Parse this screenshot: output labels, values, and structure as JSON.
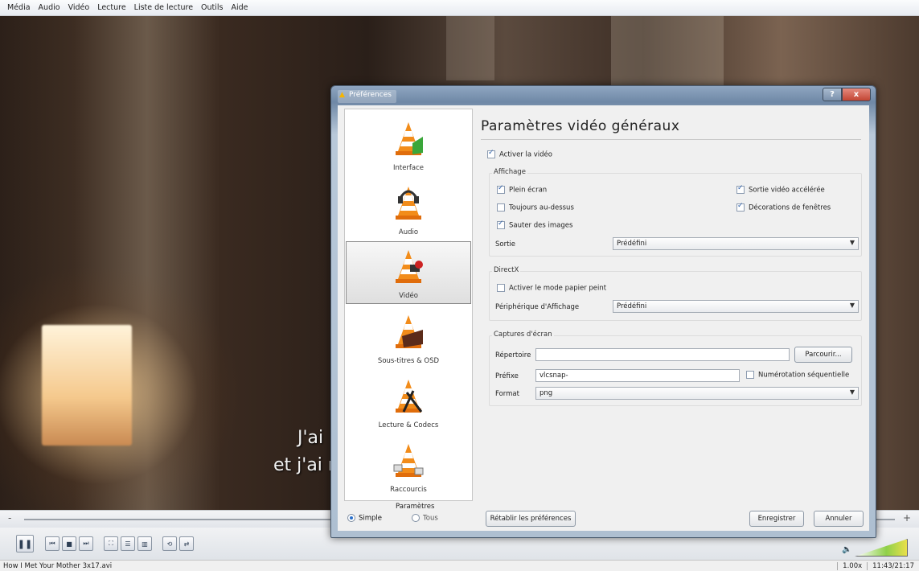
{
  "menubar": {
    "items": [
      "Média",
      "Audio",
      "Vidéo",
      "Lecture",
      "Liste de lecture",
      "Outils",
      "Aide"
    ]
  },
  "video": {
    "subtitle_line1": "J'ai",
    "subtitle_line2": "et j'ai r"
  },
  "controls": {
    "seek_minus": "-",
    "seek_plus": "+",
    "buttons": [
      {
        "name": "play-pause-button",
        "icon": "pause-icon",
        "glyph": "❚❚"
      },
      {
        "name": "previous-button",
        "icon": "previous-icon",
        "glyph": "⏮"
      },
      {
        "name": "stop-button",
        "icon": "stop-icon",
        "glyph": "■"
      },
      {
        "name": "next-button",
        "icon": "next-icon",
        "glyph": "⏭"
      },
      {
        "name": "fullscreen-button",
        "icon": "fullscreen-icon",
        "glyph": "⛶"
      },
      {
        "name": "extended-settings-button",
        "icon": "extended-settings-icon",
        "glyph": "☰"
      },
      {
        "name": "playlist-button",
        "icon": "playlist-icon",
        "glyph": "▥"
      },
      {
        "name": "loop-button",
        "icon": "loop-icon",
        "glyph": "⟲"
      },
      {
        "name": "random-button",
        "icon": "random-icon",
        "glyph": "⇄"
      }
    ],
    "volume_icon": "🔈"
  },
  "status": {
    "file": "How I Met Your Mother 3x17.avi",
    "speed": "1.00x",
    "time": "11:43/21:17"
  },
  "dialog": {
    "title": "Préférences",
    "help": "?",
    "close": "x",
    "sidebar": {
      "items": [
        {
          "label": "Interface",
          "selected": false
        },
        {
          "label": "Audio",
          "selected": false
        },
        {
          "label": "Vidéo",
          "selected": true
        },
        {
          "label": "Sous-titres & OSD",
          "selected": false
        },
        {
          "label": "Lecture & Codecs",
          "selected": false
        },
        {
          "label": "Raccourcis",
          "selected": false
        }
      ]
    },
    "params": {
      "title": "Paramètres",
      "simple": "Simple",
      "tous": "Tous",
      "selected": "simple"
    },
    "panel": {
      "title": "Paramètres vidéo généraux",
      "enable_video": {
        "label": "Activer la vidéo",
        "checked": true
      },
      "affichage": {
        "label": "Affichage",
        "plein_ecran": {
          "label": "Plein écran",
          "checked": true
        },
        "toujours_dessus": {
          "label": "Toujours au-dessus",
          "checked": false
        },
        "sauter_images": {
          "label": "Sauter des images",
          "checked": true
        },
        "sortie_acceleree": {
          "label": "Sortie vidéo accélérée",
          "checked": true
        },
        "decorations": {
          "label": "Décorations de fenêtres",
          "checked": true
        },
        "sortie_label": "Sortie",
        "sortie_value": "Prédéfini"
      },
      "directx": {
        "label": "DirectX",
        "papier_peint": {
          "label": "Activer le mode papier peint",
          "checked": false
        },
        "peripherique_label": "Périphérique d'Affichage",
        "peripherique_value": "Prédéfini"
      },
      "captures": {
        "label": "Captures d'écran",
        "repertoire_label": "Répertoire",
        "repertoire_value": "",
        "parcourir": "Parcourir...",
        "prefixe_label": "Préfixe",
        "prefixe_value": "vlcsnap-",
        "numerotation": {
          "label": "Numérotation séquentielle",
          "checked": false
        },
        "format_label": "Format",
        "format_value": "png"
      }
    },
    "buttons": {
      "reset": "Rétablir les préférences",
      "save": "Enregistrer",
      "cancel": "Annuler"
    }
  },
  "colors": {
    "dialog_frame": "#7b93b0",
    "close_button": "#c9503f",
    "vlc_orange": "#f28c1a"
  }
}
